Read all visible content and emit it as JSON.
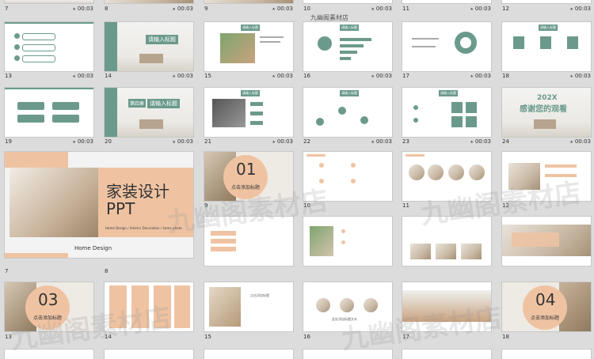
{
  "brand": {
    "top_label": "九幽阁素材店",
    "watermark": "九幽阁素材店"
  },
  "rows": [
    {
      "nums": [
        "7",
        "8",
        "9",
        "10",
        "11",
        "12"
      ],
      "times": [
        "00:03",
        "00:03",
        "00:03",
        "00:03",
        "00:03",
        "00:03"
      ]
    },
    {
      "nums": [
        "13",
        "14",
        "15",
        "16",
        "17",
        "18"
      ],
      "times": [
        "00:03",
        "00:03",
        "00:03",
        "00:03",
        "00:03",
        "00:03"
      ]
    },
    {
      "nums": [
        "19",
        "20",
        "21",
        "22",
        "23",
        "24"
      ],
      "times": [
        "00:03",
        "00:03",
        "00:03",
        "00:03",
        "00:03",
        "00:03"
      ]
    },
    {
      "nums": [
        "7",
        "8",
        "9",
        "10",
        "11",
        "12"
      ]
    },
    {
      "nums": [
        "13",
        "14",
        "15",
        "16",
        "17",
        "18"
      ]
    }
  ],
  "slides": {
    "s14_title": "请输入标题",
    "s15_header": "请输入标题",
    "s16_header": "请输入标题",
    "s18_header": "请输入标题",
    "s20_title": "请输入标题",
    "s20_part": "第四章",
    "s21_header": "请输入标题",
    "s22_header": "请输入标题",
    "s23_header": "请输入标题",
    "s24_year": "202X",
    "s24_thanks": "感谢您的观看",
    "big_title_1": "家装设计",
    "big_title_2": "PPT",
    "big_sub": "Home Design / Interior Decoration / home photo",
    "big_footer": "Home Design",
    "s3_num": "01",
    "s3_text": "点击添加标题",
    "s13_num": "03",
    "s13_text": "点击添加标题",
    "s18_num": "04",
    "s18_text": "点击添加标题",
    "small_label": "点击添加标题",
    "small_text": "此处添加标题文本"
  },
  "colors": {
    "green": "#6b9a8c",
    "peach": "#efc3a2",
    "background": "#dcdcdc"
  }
}
